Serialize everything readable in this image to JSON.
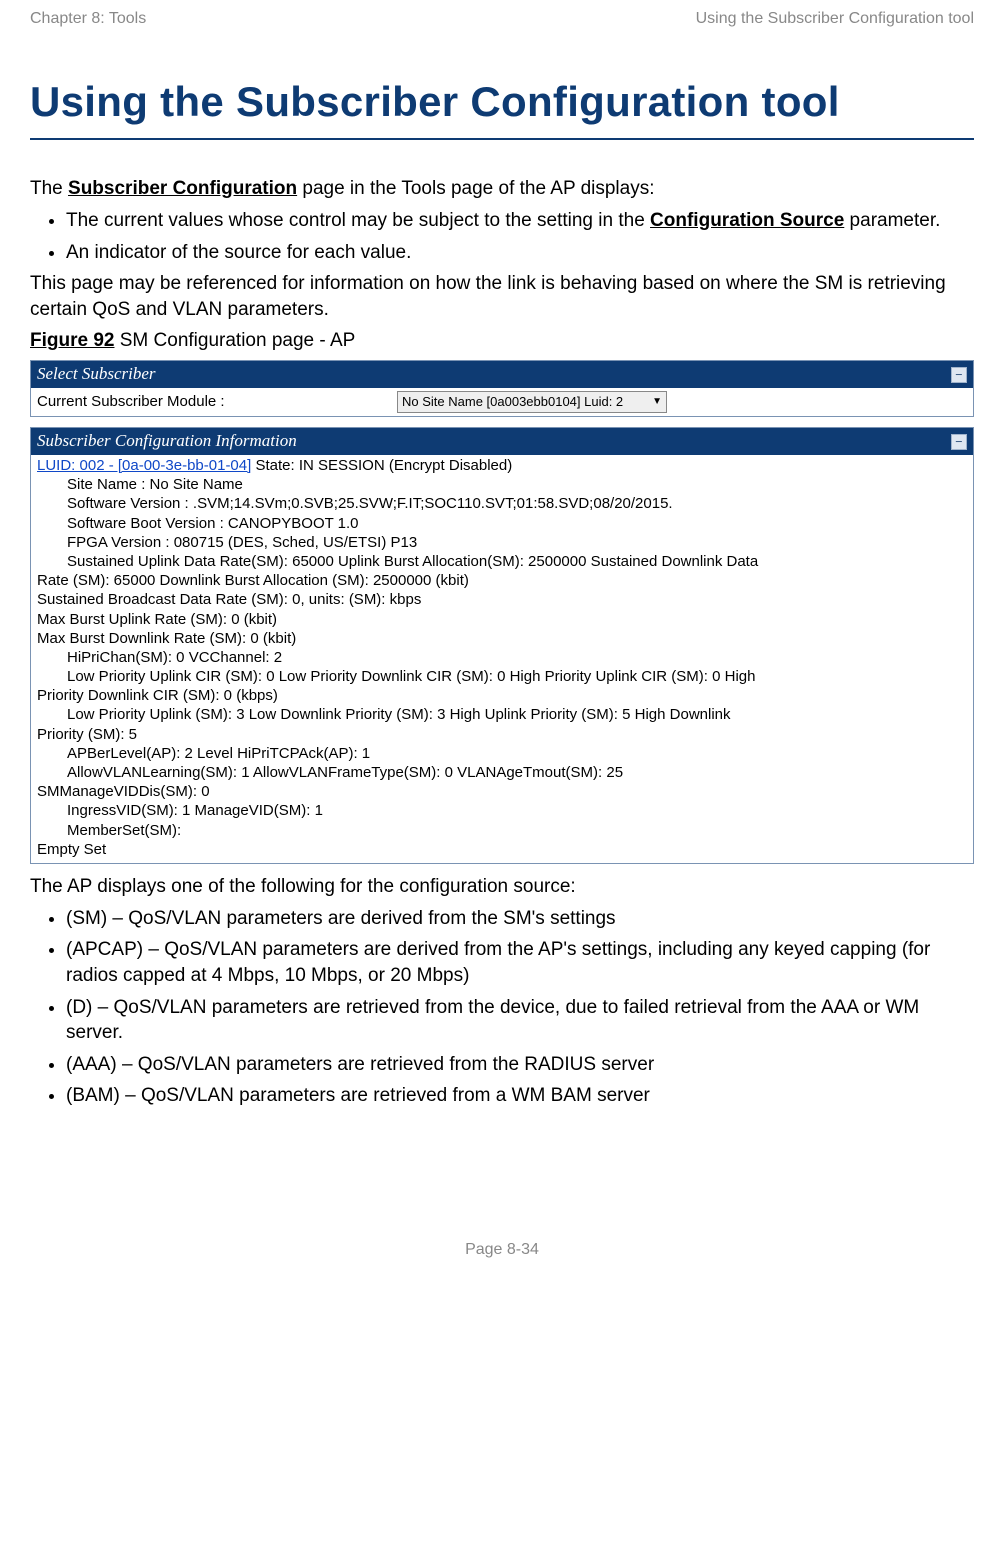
{
  "header": {
    "left": "Chapter 8:  Tools",
    "right": "Using the Subscriber Configuration tool"
  },
  "title": "Using the Subscriber Configuration tool",
  "intro_prefix": "The ",
  "intro_bold": "Subscriber Configuration",
  "intro_suffix": " page in the Tools page of the AP displays:",
  "list1": {
    "i0_prefix": "The current values whose control may be subject to the setting in the ",
    "i0_bold": "Configuration Source",
    "i0_suffix": " parameter.",
    "i1": "An indicator of the source for each value."
  },
  "para2": "This page may be referenced for information on how the link is behaving based on where the SM is retrieving certain QoS and VLAN parameters.",
  "figure": {
    "label": "Figure 92",
    "caption": "  SM Configuration page - AP"
  },
  "panel1": {
    "title": "Select Subscriber",
    "row_label": "Current Subscriber Module :",
    "select_value": "No Site Name [0a003ebb0104] Luid: 2"
  },
  "panel2": {
    "title": "Subscriber Configuration Information",
    "luid": "LUID: 002 - [0a-00-3e-bb-01-04]",
    "state": " State: IN SESSION (Encrypt Disabled)",
    "site": "Site Name : No Site Name",
    "sw": "Software Version : .SVM;14.SVm;0.SVB;25.SVW;F.IT;SOC110.SVT;01:58.SVD;08/20/2015.",
    "boot": "Software Boot Version : CANOPYBOOT 1.0",
    "fpga": "FPGA Version : 080715 (DES, Sched, US/ETSI) P13",
    "sus1a": "Sustained Uplink Data Rate(SM): 65000 Uplink Burst Allocation(SM): 2500000 Sustained Downlink Data",
    "sus1b": "Rate (SM): 65000 Downlink Burst Allocation (SM): 2500000 (kbit)",
    "sbd": "Sustained Broadcast Data Rate (SM): 0, units: (SM): kbps",
    "mbu": "Max Burst Uplink Rate (SM): 0 (kbit)",
    "mbd": "Max Burst Downlink Rate (SM): 0 (kbit)",
    "hipri": "HiPriChan(SM): 0 VCChannel: 2",
    "cir1a": "Low Priority Uplink CIR (SM): 0 Low Priority Downlink CIR (SM): 0 High Priority Uplink CIR (SM): 0 High",
    "cir1b": "Priority Downlink CIR (SM): 0 (kbps)",
    "pri2a": "Low Priority Uplink (SM): 3 Low Downlink Priority (SM): 3 High Uplink Priority (SM): 5 High Downlink",
    "pri2b": "Priority (SM): 5",
    "apber": "APBerLevel(AP): 2 Level HiPriTCPAck(AP): 1",
    "vlana": "AllowVLANLearning(SM): 1 AllowVLANFrameType(SM): 0 VLANAgeTmout(SM): 25",
    "vlanb": "SMManageVIDDis(SM): 0",
    "ingr": "IngressVID(SM): 1 ManageVID(SM): 1",
    "member": "MemberSet(SM):",
    "empty": "Empty Set"
  },
  "after_fig": "The AP displays one of the following for the configuration source:",
  "list2": {
    "i0": "(SM) – QoS/VLAN parameters are derived from the SM's settings",
    "i1": "(APCAP) – QoS/VLAN parameters are derived from the AP's settings, including any keyed capping (for radios capped at 4 Mbps, 10 Mbps, or 20 Mbps)",
    "i2": "(D) – QoS/VLAN parameters are retrieved from the device, due to failed retrieval from the AAA or WM server.",
    "i3": "(AAA) – QoS/VLAN parameters are retrieved from the RADIUS server",
    "i4": "(BAM) – QoS/VLAN parameters are retrieved from a WM BAM server"
  },
  "footer": "Page 8-34"
}
